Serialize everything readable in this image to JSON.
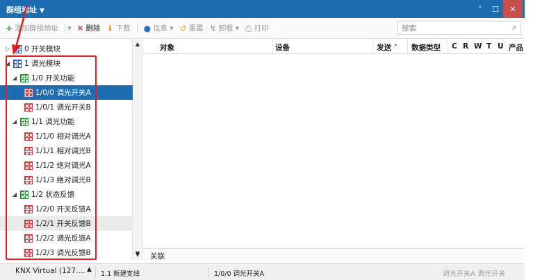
{
  "window": {
    "title": "群组地址"
  },
  "toolbar": {
    "add": "添加群组地址",
    "delete": "删除",
    "download": "下载",
    "info": "信息",
    "reset": "重置",
    "unload": "卸载",
    "print": "打印",
    "search_placeholder": "搜索"
  },
  "tree": {
    "items": [
      {
        "label": "0 开关模块"
      },
      {
        "label": "1 调光模块"
      },
      {
        "label": "1/0 开关功能"
      },
      {
        "label": "1/0/0 调光开关A"
      },
      {
        "label": "1/0/1 调光开关B"
      },
      {
        "label": "1/1 调光功能"
      },
      {
        "label": "1/1/0 相对调光A"
      },
      {
        "label": "1/1/1 相对调光B"
      },
      {
        "label": "1/1/2 绝对调光A"
      },
      {
        "label": "1/1/3 绝对调光B"
      },
      {
        "label": "1/2 状态反馈"
      },
      {
        "label": "1/2/0 开关反馈A"
      },
      {
        "label": "1/2/1 开关反馈B"
      },
      {
        "label": "1/2/2 调光反馈A"
      },
      {
        "label": "1/2/3 调光反馈B"
      }
    ]
  },
  "table": {
    "columns": [
      "对象",
      "设备",
      "发送 ˄",
      "数据类型",
      "C",
      "R",
      "W",
      "T",
      "U",
      "产品"
    ]
  },
  "bottom_tab": "关联",
  "statusbar": {
    "interface": "KNX Virtual  (127....",
    "line": "1.1 新建支线",
    "selection": "1/0/0 调光开关A",
    "right": "调光开关A 调光开关"
  }
}
